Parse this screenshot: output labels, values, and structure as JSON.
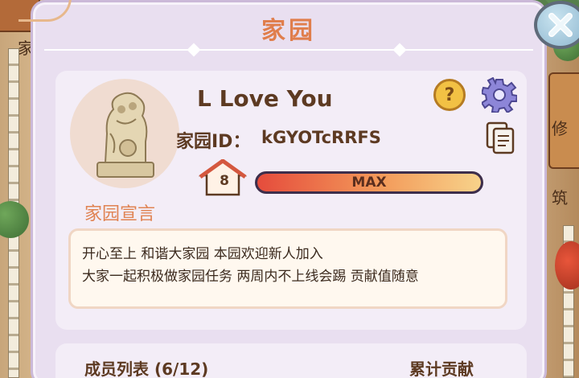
{
  "dialog": {
    "title": "家园",
    "close_icon": "close-x-icon"
  },
  "profile": {
    "name": "L Love You",
    "id_label": "家园ID：",
    "id_value": "kGYOTcRRFS",
    "level": "8",
    "exp_label": "MAX",
    "exp_progress": 1.0,
    "motto_label": "家园宣言",
    "motto_lines": [
      "开心至上 和谐大家园 本园欢迎新人加入",
      "大家一起积极做家园任务 两周内不上线会踢 贡献值随意"
    ],
    "icons": {
      "help": "question-icon",
      "settings": "gear-icon",
      "copy": "copy-icon",
      "avatar": "stone-lion-icon",
      "level": "house-icon"
    }
  },
  "members": {
    "title": "成员列表 (6/12)",
    "column": "累计贡献"
  },
  "background": {
    "labels": [
      "家",
      "修",
      "筑"
    ]
  },
  "colors": {
    "title": "#e07e4c",
    "panel": "#e9dff0",
    "text": "#5d3a22"
  }
}
